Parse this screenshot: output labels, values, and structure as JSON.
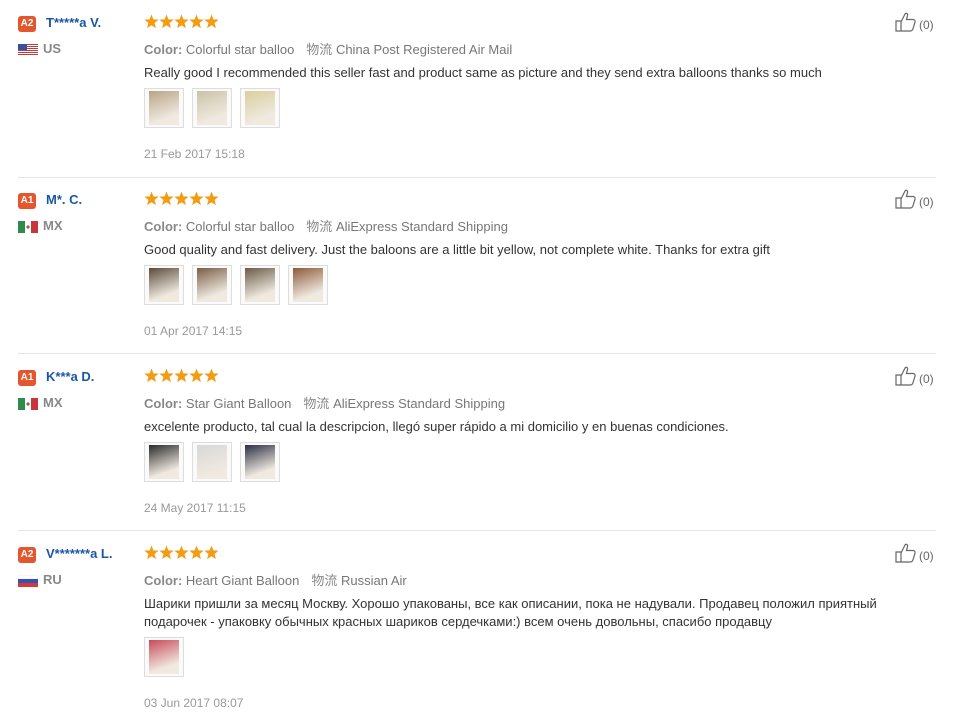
{
  "reviews": [
    {
      "level": "A2",
      "name": "T*****a V.",
      "country": "US",
      "flag": "us-flag-icon",
      "rating": 5,
      "color_label": "Color:",
      "color_value": "Colorful star balloo",
      "shipping_label": "物流",
      "shipping_value": "China Post Registered Air Mail",
      "text": "Really good I recommended this seller fast and product same as picture and they send extra balloons thanks so much",
      "photo_count": 3,
      "photo_colors": [
        "#b9a487",
        "#c9c3a8",
        "#d9cf9d"
      ],
      "date": "21 Feb 2017 15:18",
      "helpful": "(0)"
    },
    {
      "level": "A1",
      "name": "M*. C.",
      "country": "MX",
      "flag": "mx-flag-icon",
      "rating": 5,
      "color_label": "Color:",
      "color_value": "Colorful star balloo",
      "shipping_label": "物流",
      "shipping_value": "AliExpress Standard Shipping",
      "text": "Good quality and fast delivery. Just the baloons are a little bit yellow, not complete white. Thanks for extra gift",
      "photo_count": 4,
      "photo_colors": [
        "#5a4a3c",
        "#7a5d46",
        "#6b5a48",
        "#8c5a3c"
      ],
      "date": "01 Apr 2017 14:15",
      "helpful": "(0)"
    },
    {
      "level": "A1",
      "name": "K***a D.",
      "country": "MX",
      "flag": "mx-flag-icon",
      "rating": 5,
      "color_label": "Color:",
      "color_value": "Star Giant Balloon",
      "shipping_label": "物流",
      "shipping_value": "AliExpress Standard Shipping",
      "text": "excelente producto, tal cual la descripcion, llegó super rápido a mi domicilio y en buenas condiciones.",
      "photo_count": 3,
      "photo_colors": [
        "#2a2a2a",
        "#d8d8d8",
        "#2c2f45"
      ],
      "date": "24 May 2017 11:15",
      "helpful": "(0)"
    },
    {
      "level": "A2",
      "name": "V*******a L.",
      "country": "RU",
      "flag": "ru-flag-icon",
      "rating": 5,
      "color_label": "Color:",
      "color_value": "Heart Giant Balloon",
      "shipping_label": "物流",
      "shipping_value": "Russian Air",
      "text": "Шарики пришли за месяц Москву. Хорошо упакованы, все как описании, пока не надували. Продавец положил приятный подарочек - упаковку обычных красных шариков сердечками:) всем очень довольны, спасибо продавцу",
      "photo_count": 1,
      "photo_colors": [
        "#c94a5a"
      ],
      "date": "03 Jun 2017 08:07",
      "helpful": "(0)"
    }
  ],
  "colors": {
    "badge": "#e4572e",
    "name": "#1a56a8",
    "star": "#f39c12",
    "separator": "#e6e6e6"
  }
}
